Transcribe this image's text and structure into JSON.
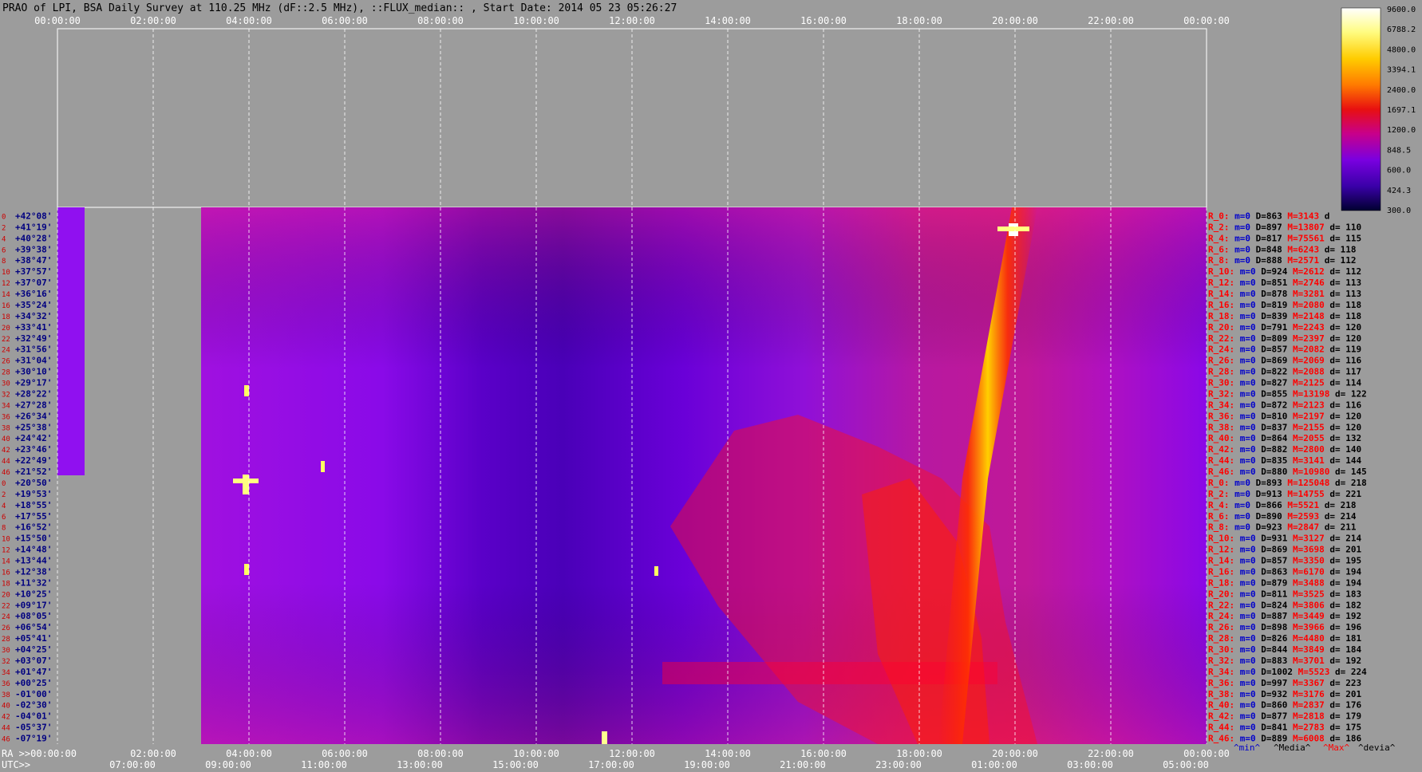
{
  "chart_data": {
    "type": "heatmap",
    "title": "PRAO of LPI, BSA Daily Survey at 110.25 MHz (dF::2.5 MHz), ::FLUX_median:: , Start Date: 2014 05 23 05:26:27",
    "top_axis_ticks": [
      "00:00:00",
      "02:00:00",
      "04:00:00",
      "06:00:00",
      "08:00:00",
      "10:00:00",
      "12:00:00",
      "14:00:00",
      "16:00:00",
      "18:00:00",
      "20:00:00",
      "22:00:00",
      "00:00:00"
    ],
    "ra_axis": {
      "label": "RA >>00:00:00",
      "ticks": [
        "02:00:00",
        "04:00:00",
        "06:00:00",
        "08:00:00",
        "10:00:00",
        "12:00:00",
        "14:00:00",
        "16:00:00",
        "18:00:00",
        "20:00:00",
        "22:00:00",
        "00:00:00"
      ]
    },
    "utc_axis": {
      "label": "UTC>>",
      "ticks": [
        "07:00:00",
        "09:00:00",
        "11:00:00",
        "13:00:00",
        "15:00:00",
        "17:00:00",
        "19:00:00",
        "21:00:00",
        "23:00:00",
        "01:00:00",
        "03:00:00",
        "05:00:00"
      ]
    },
    "colorbar": {
      "min": 300,
      "max": 9600,
      "ticks": [
        "9600.0",
        "6788.2",
        "4800.0",
        "3394.1",
        "2400.0",
        "1697.1",
        "1200.0",
        "848.5",
        "600.0",
        "424.3",
        "300.0"
      ]
    },
    "rows": [
      {
        "idx": "0",
        "dec": "+42°08'",
        "r": "R_0:",
        "m": "m=0",
        "D": "D=863",
        "M": "M=3143",
        "d": "d"
      },
      {
        "idx": "2",
        "dec": "+41°19'",
        "r": "R_2:",
        "m": "m=0",
        "D": "D=897",
        "M": "M=13807",
        "d": "d= 110"
      },
      {
        "idx": "4",
        "dec": "+40°28'",
        "r": "R_4:",
        "m": "m=0",
        "D": "D=817",
        "M": "M=75561",
        "d": "d= 115"
      },
      {
        "idx": "6",
        "dec": "+39°38'",
        "r": "R_6:",
        "m": "m=0",
        "D": "D=848",
        "M": "M=6243",
        "d": "d= 118"
      },
      {
        "idx": "8",
        "dec": "+38°47'",
        "r": "R_8:",
        "m": "m=0",
        "D": "D=888",
        "M": "M=2571",
        "d": "d= 112"
      },
      {
        "idx": "10",
        "dec": "+37°57'",
        "r": "R_10:",
        "m": "m=0",
        "D": "D=924",
        "M": "M=2612",
        "d": "d= 112"
      },
      {
        "idx": "12",
        "dec": "+37°07'",
        "r": "R_12:",
        "m": "m=0",
        "D": "D=851",
        "M": "M=2746",
        "d": "d= 113"
      },
      {
        "idx": "14",
        "dec": "+36°16'",
        "r": "R_14:",
        "m": "m=0",
        "D": "D=878",
        "M": "M=3281",
        "d": "d= 113"
      },
      {
        "idx": "16",
        "dec": "+35°24'",
        "r": "R_16:",
        "m": "m=0",
        "D": "D=819",
        "M": "M=2080",
        "d": "d= 118"
      },
      {
        "idx": "18",
        "dec": "+34°32'",
        "r": "R_18:",
        "m": "m=0",
        "D": "D=839",
        "M": "M=2148",
        "d": "d= 118"
      },
      {
        "idx": "20",
        "dec": "+33°41'",
        "r": "R_20:",
        "m": "m=0",
        "D": "D=791",
        "M": "M=2243",
        "d": "d= 120"
      },
      {
        "idx": "22",
        "dec": "+32°49'",
        "r": "R_22:",
        "m": "m=0",
        "D": "D=809",
        "M": "M=2397",
        "d": "d= 120"
      },
      {
        "idx": "24",
        "dec": "+31°56'",
        "r": "R_24:",
        "m": "m=0",
        "D": "D=857",
        "M": "M=2082",
        "d": "d= 119"
      },
      {
        "idx": "26",
        "dec": "+31°04'",
        "r": "R_26:",
        "m": "m=0",
        "D": "D=869",
        "M": "M=2069",
        "d": "d= 116"
      },
      {
        "idx": "28",
        "dec": "+30°10'",
        "r": "R_28:",
        "m": "m=0",
        "D": "D=822",
        "M": "M=2088",
        "d": "d= 117"
      },
      {
        "idx": "30",
        "dec": "+29°17'",
        "r": "R_30:",
        "m": "m=0",
        "D": "D=827",
        "M": "M=2125",
        "d": "d= 114"
      },
      {
        "idx": "32",
        "dec": "+28°22'",
        "r": "R_32:",
        "m": "m=0",
        "D": "D=855",
        "M": "M=13198",
        "d": "d= 122"
      },
      {
        "idx": "34",
        "dec": "+27°28'",
        "r": "R_34:",
        "m": "m=0",
        "D": "D=872",
        "M": "M=2123",
        "d": "d= 116"
      },
      {
        "idx": "36",
        "dec": "+26°34'",
        "r": "R_36:",
        "m": "m=0",
        "D": "D=810",
        "M": "M=2197",
        "d": "d= 120"
      },
      {
        "idx": "38",
        "dec": "+25°38'",
        "r": "R_38:",
        "m": "m=0",
        "D": "D=837",
        "M": "M=2155",
        "d": "d= 120"
      },
      {
        "idx": "40",
        "dec": "+24°42'",
        "r": "R_40:",
        "m": "m=0",
        "D": "D=864",
        "M": "M=2055",
        "d": "d= 132"
      },
      {
        "idx": "42",
        "dec": "+23°46'",
        "r": "R_42:",
        "m": "m=0",
        "D": "D=882",
        "M": "M=2800",
        "d": "d= 140"
      },
      {
        "idx": "44",
        "dec": "+22°49'",
        "r": "R_44:",
        "m": "m=0",
        "D": "D=835",
        "M": "M=3141",
        "d": "d= 144"
      },
      {
        "idx": "46",
        "dec": "+21°52'",
        "r": "R_46:",
        "m": "m=0",
        "D": "D=880",
        "M": "M=10980",
        "d": "d= 145"
      },
      {
        "idx": "0",
        "dec": "+20°50'",
        "r": "R_0:",
        "m": "m=0",
        "D": "D=893",
        "M": "M=125048",
        "d": "d= 218"
      },
      {
        "idx": "2",
        "dec": "+19°53'",
        "r": "R_2:",
        "m": "m=0",
        "D": "D=913",
        "M": "M=14755",
        "d": "d= 221"
      },
      {
        "idx": "4",
        "dec": "+18°55'",
        "r": "R_4:",
        "m": "m=0",
        "D": "D=866",
        "M": "M=5521",
        "d": "d= 218"
      },
      {
        "idx": "6",
        "dec": "+17°55'",
        "r": "R_6:",
        "m": "m=0",
        "D": "D=890",
        "M": "M=2593",
        "d": "d= 214"
      },
      {
        "idx": "8",
        "dec": "+16°52'",
        "r": "R_8:",
        "m": "m=0",
        "D": "D=923",
        "M": "M=2847",
        "d": "d= 211"
      },
      {
        "idx": "10",
        "dec": "+15°50'",
        "r": "R_10:",
        "m": "m=0",
        "D": "D=931",
        "M": "M=3127",
        "d": "d= 214"
      },
      {
        "idx": "12",
        "dec": "+14°48'",
        "r": "R_12:",
        "m": "m=0",
        "D": "D=869",
        "M": "M=3698",
        "d": "d= 201"
      },
      {
        "idx": "14",
        "dec": "+13°44'",
        "r": "R_14:",
        "m": "m=0",
        "D": "D=857",
        "M": "M=3350",
        "d": "d= 195"
      },
      {
        "idx": "16",
        "dec": "+12°38'",
        "r": "R_16:",
        "m": "m=0",
        "D": "D=863",
        "M": "M=6170",
        "d": "d= 194"
      },
      {
        "idx": "18",
        "dec": "+11°32'",
        "r": "R_18:",
        "m": "m=0",
        "D": "D=879",
        "M": "M=3488",
        "d": "d= 194"
      },
      {
        "idx": "20",
        "dec": "+10°25'",
        "r": "R_20:",
        "m": "m=0",
        "D": "D=811",
        "M": "M=3525",
        "d": "d= 183"
      },
      {
        "idx": "22",
        "dec": "+09°17'",
        "r": "R_22:",
        "m": "m=0",
        "D": "D=824",
        "M": "M=3806",
        "d": "d= 182"
      },
      {
        "idx": "24",
        "dec": "+08°05'",
        "r": "R_24:",
        "m": "m=0",
        "D": "D=887",
        "M": "M=3449",
        "d": "d= 192"
      },
      {
        "idx": "26",
        "dec": "+06°54'",
        "r": "R_26:",
        "m": "m=0",
        "D": "D=898",
        "M": "M=3966",
        "d": "d= 196"
      },
      {
        "idx": "28",
        "dec": "+05°41'",
        "r": "R_28:",
        "m": "m=0",
        "D": "D=826",
        "M": "M=4480",
        "d": "d= 181"
      },
      {
        "idx": "30",
        "dec": "+04°25'",
        "r": "R_30:",
        "m": "m=0",
        "D": "D=844",
        "M": "M=3849",
        "d": "d= 184"
      },
      {
        "idx": "32",
        "dec": "+03°07'",
        "r": "R_32:",
        "m": "m=0",
        "D": "D=883",
        "M": "M=3701",
        "d": "d= 192"
      },
      {
        "idx": "34",
        "dec": "+01°47'",
        "r": "R_34:",
        "m": "m=0",
        "D": "D=1002",
        "M": "M=5523",
        "d": "d= 224"
      },
      {
        "idx": "36",
        "dec": "+00°25'",
        "r": "R_36:",
        "m": "m=0",
        "D": "D=997",
        "M": "M=3367",
        "d": "d= 223"
      },
      {
        "idx": "38",
        "dec": "-01°00'",
        "r": "R_38:",
        "m": "m=0",
        "D": "D=932",
        "M": "M=3176",
        "d": "d= 201"
      },
      {
        "idx": "40",
        "dec": "-02°30'",
        "r": "R_40:",
        "m": "m=0",
        "D": "D=860",
        "M": "M=2837",
        "d": "d= 176"
      },
      {
        "idx": "42",
        "dec": "-04°01'",
        "r": "R_42:",
        "m": "m=0",
        "D": "D=877",
        "M": "M=2818",
        "d": "d= 179"
      },
      {
        "idx": "44",
        "dec": "-05°37'",
        "r": "R_44:",
        "m": "m=0",
        "D": "D=841",
        "M": "M=2783",
        "d": "d= 175"
      },
      {
        "idx": "46",
        "dec": "-07°19'",
        "r": "R_46:",
        "m": "m=0",
        "D": "D=889",
        "M": "M=6008",
        "d": "d= 186"
      }
    ],
    "column_key": [
      "^min^",
      "^Media^",
      "^Max^",
      "^devia^"
    ],
    "colors": {
      "background": "#9c9c9c",
      "title_text": "#000000",
      "axis_text": "#ffffff",
      "dec_text": "#000080",
      "idx_text": "#cc0000",
      "r_text": "#ff0000",
      "m_text": "#0000cc",
      "D_text": "#000000",
      "M_text": "#ff0000",
      "d_text": "#000000",
      "grid": "#ffffff"
    }
  }
}
